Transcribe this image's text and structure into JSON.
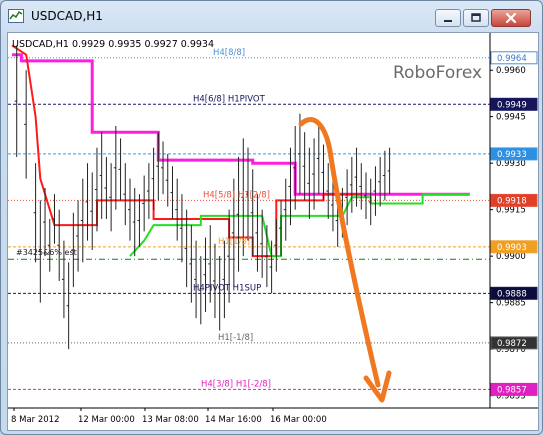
{
  "window": {
    "title": "USDCAD,H1"
  },
  "brand": "RoboForex",
  "chart_data": {
    "type": "candlestick",
    "symbol_header": "USDCAD,H1  0.9929 0.9935 0.9927 0.9934",
    "ylim": [
      0.9851,
      0.9972
    ],
    "y_ticks": [
      {
        "value": 0.996,
        "label": "0.9960"
      },
      {
        "value": 0.9945,
        "label": "0.9945"
      },
      {
        "value": 0.993,
        "label": "0.9930"
      },
      {
        "value": 0.9915,
        "label": "0.9915"
      },
      {
        "value": 0.99,
        "label": "0.9900"
      },
      {
        "value": 0.9885,
        "label": "0.9885"
      },
      {
        "value": 0.987,
        "label": "0.9870"
      },
      {
        "value": 0.9855,
        "label": "0.9855"
      }
    ],
    "x_ticks": [
      "8 Mar 2012",
      "12 Mar 00:00",
      "13 Mar 08:00",
      "14 Mar 16:00",
      "16 Mar 00:00"
    ],
    "levels": [
      {
        "value": 0.9964,
        "label": "H4[8/8]",
        "tag": "0.9964",
        "color": "#4a90d9",
        "tag_bg": "#ffffff",
        "tag_fg": "#3a78c8",
        "style": "dot"
      },
      {
        "value": 0.9949,
        "label": "H4[6/8] H1PIVOT",
        "tag": "0.9949",
        "color": "#1a1a66",
        "tag_bg": "#15155a",
        "tag_fg": "#ffffff",
        "style": "dash"
      },
      {
        "value": 0.9933,
        "label": "",
        "tag": "0.9933",
        "color": "#3a9be6",
        "tag_bg": "#2e8fe0",
        "tag_fg": "#ffffff",
        "style": "dash"
      },
      {
        "value": 0.9918,
        "label": "H4[5/8] H1[2/8]",
        "tag": "0.9918",
        "color": "#e8503a",
        "tag_bg": "#e0402a",
        "tag_fg": "#ffffff",
        "style": "dot"
      },
      {
        "value": 0.9903,
        "label": "H1[1/8]",
        "tag": "0.9903",
        "color": "#f0a030",
        "tag_bg": "#f0a020",
        "tag_fg": "#ffffff",
        "style": "dash"
      },
      {
        "value": 0.9888,
        "label": "H4PIVOT H1SUP",
        "tag": "0.9888",
        "color": "#1a1a55",
        "tag_bg": "#0c0c3a",
        "tag_fg": "#ffffff",
        "style": "dash"
      },
      {
        "value": 0.9872,
        "label": "H1[-1/8]",
        "tag": "0.9872",
        "color": "#666666",
        "tag_bg": "#333333",
        "tag_fg": "#ffffff",
        "style": "dot"
      },
      {
        "value": 0.9857,
        "label": "H4[3/8] H1[-2/8]",
        "tag": "0.9857",
        "color": "#e020c0",
        "tag_bg": "#e020c0",
        "tag_fg": "#ffffff",
        "style": "dash"
      }
    ],
    "green_line_value": 0.9899,
    "left_annotation": "#3425&6% est",
    "step_lines": [
      {
        "name": "magenta",
        "color": "#ff1ee0",
        "points": [
          [
            0.0,
            0.9965
          ],
          [
            0.02,
            0.9965
          ],
          [
            0.02,
            0.9963
          ],
          [
            0.17,
            0.9963
          ],
          [
            0.17,
            0.994
          ],
          [
            0.31,
            0.994
          ],
          [
            0.31,
            0.9931
          ],
          [
            0.51,
            0.9931
          ],
          [
            0.51,
            0.993
          ],
          [
            0.6,
            0.993
          ],
          [
            0.6,
            0.992
          ],
          [
            0.97,
            0.992
          ]
        ]
      },
      {
        "name": "red",
        "color": "#ff1a1a",
        "points": [
          [
            0.0,
            0.9968
          ],
          [
            0.03,
            0.9965
          ],
          [
            0.05,
            0.9945
          ],
          [
            0.06,
            0.9925
          ],
          [
            0.09,
            0.991
          ],
          [
            0.18,
            0.991
          ],
          [
            0.18,
            0.9918
          ],
          [
            0.3,
            0.9918
          ],
          [
            0.3,
            0.9912
          ],
          [
            0.46,
            0.9912
          ],
          [
            0.46,
            0.9906
          ],
          [
            0.51,
            0.9906
          ],
          [
            0.51,
            0.99
          ],
          [
            0.56,
            0.99
          ],
          [
            0.56,
            0.9918
          ],
          [
            0.66,
            0.9918
          ],
          [
            0.66,
            0.992
          ],
          [
            0.74,
            0.992
          ]
        ]
      },
      {
        "name": "green",
        "color": "#22e022",
        "points": [
          [
            0.25,
            0.99
          ],
          [
            0.28,
            0.9905
          ],
          [
            0.3,
            0.991
          ],
          [
            0.4,
            0.991
          ],
          [
            0.4,
            0.9913
          ],
          [
            0.53,
            0.9913
          ],
          [
            0.55,
            0.99
          ],
          [
            0.57,
            0.99
          ],
          [
            0.57,
            0.9913
          ],
          [
            0.7,
            0.9913
          ],
          [
            0.72,
            0.9919
          ],
          [
            0.76,
            0.9919
          ],
          [
            0.76,
            0.9917
          ],
          [
            0.87,
            0.9917
          ],
          [
            0.87,
            0.992
          ],
          [
            0.97,
            0.992
          ]
        ]
      }
    ],
    "bars": [
      [
        0.01,
        0.9932,
        0.9968
      ],
      [
        0.03,
        0.9925,
        0.996
      ],
      [
        0.05,
        0.9898,
        0.993
      ],
      [
        0.06,
        0.9885,
        0.9918
      ],
      [
        0.07,
        0.99,
        0.9922
      ],
      [
        0.08,
        0.9895,
        0.9912
      ],
      [
        0.09,
        0.9904,
        0.992
      ],
      [
        0.1,
        0.9892,
        0.9915
      ],
      [
        0.11,
        0.988,
        0.9905
      ],
      [
        0.12,
        0.987,
        0.9898
      ],
      [
        0.13,
        0.989,
        0.9914
      ],
      [
        0.14,
        0.9895,
        0.9918
      ],
      [
        0.15,
        0.9898,
        0.9925
      ],
      [
        0.16,
        0.9905,
        0.993
      ],
      [
        0.17,
        0.9902,
        0.9927
      ],
      [
        0.18,
        0.9908,
        0.9935
      ],
      [
        0.19,
        0.9912,
        0.994
      ],
      [
        0.2,
        0.9912,
        0.9932
      ],
      [
        0.21,
        0.9908,
        0.993
      ],
      [
        0.22,
        0.9915,
        0.9942
      ],
      [
        0.23,
        0.9918,
        0.9938
      ],
      [
        0.24,
        0.991,
        0.993
      ],
      [
        0.25,
        0.9905,
        0.9925
      ],
      [
        0.26,
        0.99,
        0.9922
      ],
      [
        0.27,
        0.9903,
        0.992
      ],
      [
        0.28,
        0.9908,
        0.9926
      ],
      [
        0.29,
        0.9912,
        0.993
      ],
      [
        0.3,
        0.9915,
        0.9935
      ],
      [
        0.31,
        0.9918,
        0.994
      ],
      [
        0.32,
        0.992,
        0.9937
      ],
      [
        0.33,
        0.9916,
        0.9933
      ],
      [
        0.34,
        0.9912,
        0.9929
      ],
      [
        0.35,
        0.9905,
        0.9925
      ],
      [
        0.36,
        0.9898,
        0.992
      ],
      [
        0.37,
        0.989,
        0.9915
      ],
      [
        0.38,
        0.9885,
        0.991
      ],
      [
        0.39,
        0.988,
        0.9905
      ],
      [
        0.4,
        0.9878,
        0.99
      ],
      [
        0.41,
        0.9882,
        0.9906
      ],
      [
        0.42,
        0.9885,
        0.991
      ],
      [
        0.43,
        0.988,
        0.9904
      ],
      [
        0.44,
        0.9876,
        0.99
      ],
      [
        0.45,
        0.988,
        0.9905
      ],
      [
        0.46,
        0.9885,
        0.9915
      ],
      [
        0.47,
        0.989,
        0.9925
      ],
      [
        0.48,
        0.9895,
        0.9932
      ],
      [
        0.49,
        0.99,
        0.9938
      ],
      [
        0.5,
        0.9905,
        0.9935
      ],
      [
        0.51,
        0.99,
        0.9928
      ],
      [
        0.52,
        0.9895,
        0.992
      ],
      [
        0.53,
        0.9893,
        0.9915
      ],
      [
        0.54,
        0.989,
        0.991
      ],
      [
        0.55,
        0.9888,
        0.9905
      ],
      [
        0.56,
        0.9895,
        0.9912
      ],
      [
        0.57,
        0.99,
        0.9918
      ],
      [
        0.58,
        0.9905,
        0.9925
      ],
      [
        0.59,
        0.991,
        0.9935
      ],
      [
        0.6,
        0.9915,
        0.9942
      ],
      [
        0.61,
        0.992,
        0.9946
      ],
      [
        0.62,
        0.9918,
        0.994
      ],
      [
        0.63,
        0.9912,
        0.9935
      ],
      [
        0.64,
        0.9915,
        0.9938
      ],
      [
        0.65,
        0.992,
        0.9943
      ],
      [
        0.66,
        0.9918,
        0.9936
      ],
      [
        0.67,
        0.9912,
        0.993
      ],
      [
        0.68,
        0.9908,
        0.9925
      ],
      [
        0.69,
        0.9903,
        0.992
      ],
      [
        0.7,
        0.9906,
        0.9922
      ],
      [
        0.71,
        0.991,
        0.9928
      ],
      [
        0.72,
        0.9914,
        0.9932
      ],
      [
        0.73,
        0.9916,
        0.9935
      ],
      [
        0.74,
        0.9915,
        0.993
      ],
      [
        0.75,
        0.9912,
        0.9927
      ],
      [
        0.76,
        0.991,
        0.9925
      ],
      [
        0.77,
        0.9913,
        0.9929
      ],
      [
        0.78,
        0.9916,
        0.9932
      ],
      [
        0.79,
        0.9918,
        0.9934
      ],
      [
        0.8,
        0.992,
        0.9935
      ]
    ],
    "forecast_arrow": {
      "color": "#f07820",
      "direction": "down"
    }
  }
}
